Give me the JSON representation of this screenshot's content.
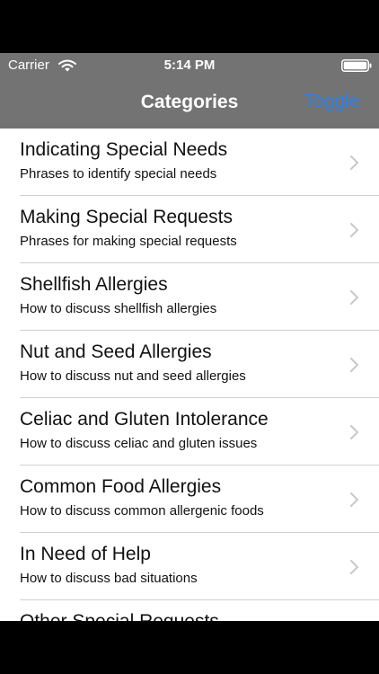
{
  "status_bar": {
    "carrier": "Carrier",
    "time": "5:14 PM"
  },
  "nav_bar": {
    "title": "Categories",
    "toggle_label": "Toggle"
  },
  "categories": [
    {
      "title": "Indicating Special Needs",
      "subtitle": "Phrases to identify special needs"
    },
    {
      "title": "Making Special Requests",
      "subtitle": "Phrases for making special requests"
    },
    {
      "title": "Shellfish Allergies",
      "subtitle": "How to discuss shellfish allergies"
    },
    {
      "title": "Nut and Seed Allergies",
      "subtitle": "How to discuss nut and seed allergies"
    },
    {
      "title": "Celiac and Gluten Intolerance",
      "subtitle": "How to discuss celiac and gluten issues"
    },
    {
      "title": "Common Food Allergies",
      "subtitle": "How to discuss common allergenic foods"
    },
    {
      "title": "In Need of Help",
      "subtitle": "How to discuss bad situations"
    },
    {
      "title": "Other Special Requests",
      "subtitle": ""
    }
  ],
  "icons": {
    "wifi": "wifi-icon",
    "battery": "battery-icon",
    "chevron": "chevron-right-icon"
  },
  "colors": {
    "nav_background": "#737373",
    "toggle_accent": "#2f80e6",
    "chevron": "#c7c7cc"
  }
}
